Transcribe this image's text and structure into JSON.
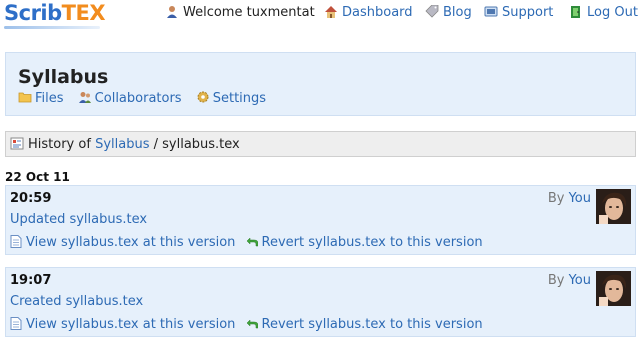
{
  "header": {
    "logo_left": "Scrib",
    "logo_right": "TEX",
    "welcome": "Welcome tuxmentat",
    "nav": {
      "dashboard": "Dashboard",
      "blog": "Blog",
      "support": "Support",
      "logout": "Log Out"
    }
  },
  "project": {
    "title": "Syllabus",
    "tabs": {
      "files": "Files",
      "collaborators": "Collaborators",
      "settings": "Settings"
    }
  },
  "breadcrumb": {
    "prefix": "History of",
    "project_link": "Syllabus",
    "separator": " / ",
    "file": "syllabus.tex"
  },
  "history": {
    "date": "22 Oct 11",
    "entries": [
      {
        "time": "20:59",
        "message": "Updated syllabus.tex",
        "view_label": "View syllabus.tex at this version",
        "revert_label": "Revert syllabus.tex to this version",
        "by_prefix": "By",
        "author": "You"
      },
      {
        "time": "19:07",
        "message": "Created syllabus.tex",
        "view_label": "View syllabus.tex at this version",
        "revert_label": "Revert syllabus.tex to this version",
        "by_prefix": "By",
        "author": "You"
      }
    ]
  }
}
